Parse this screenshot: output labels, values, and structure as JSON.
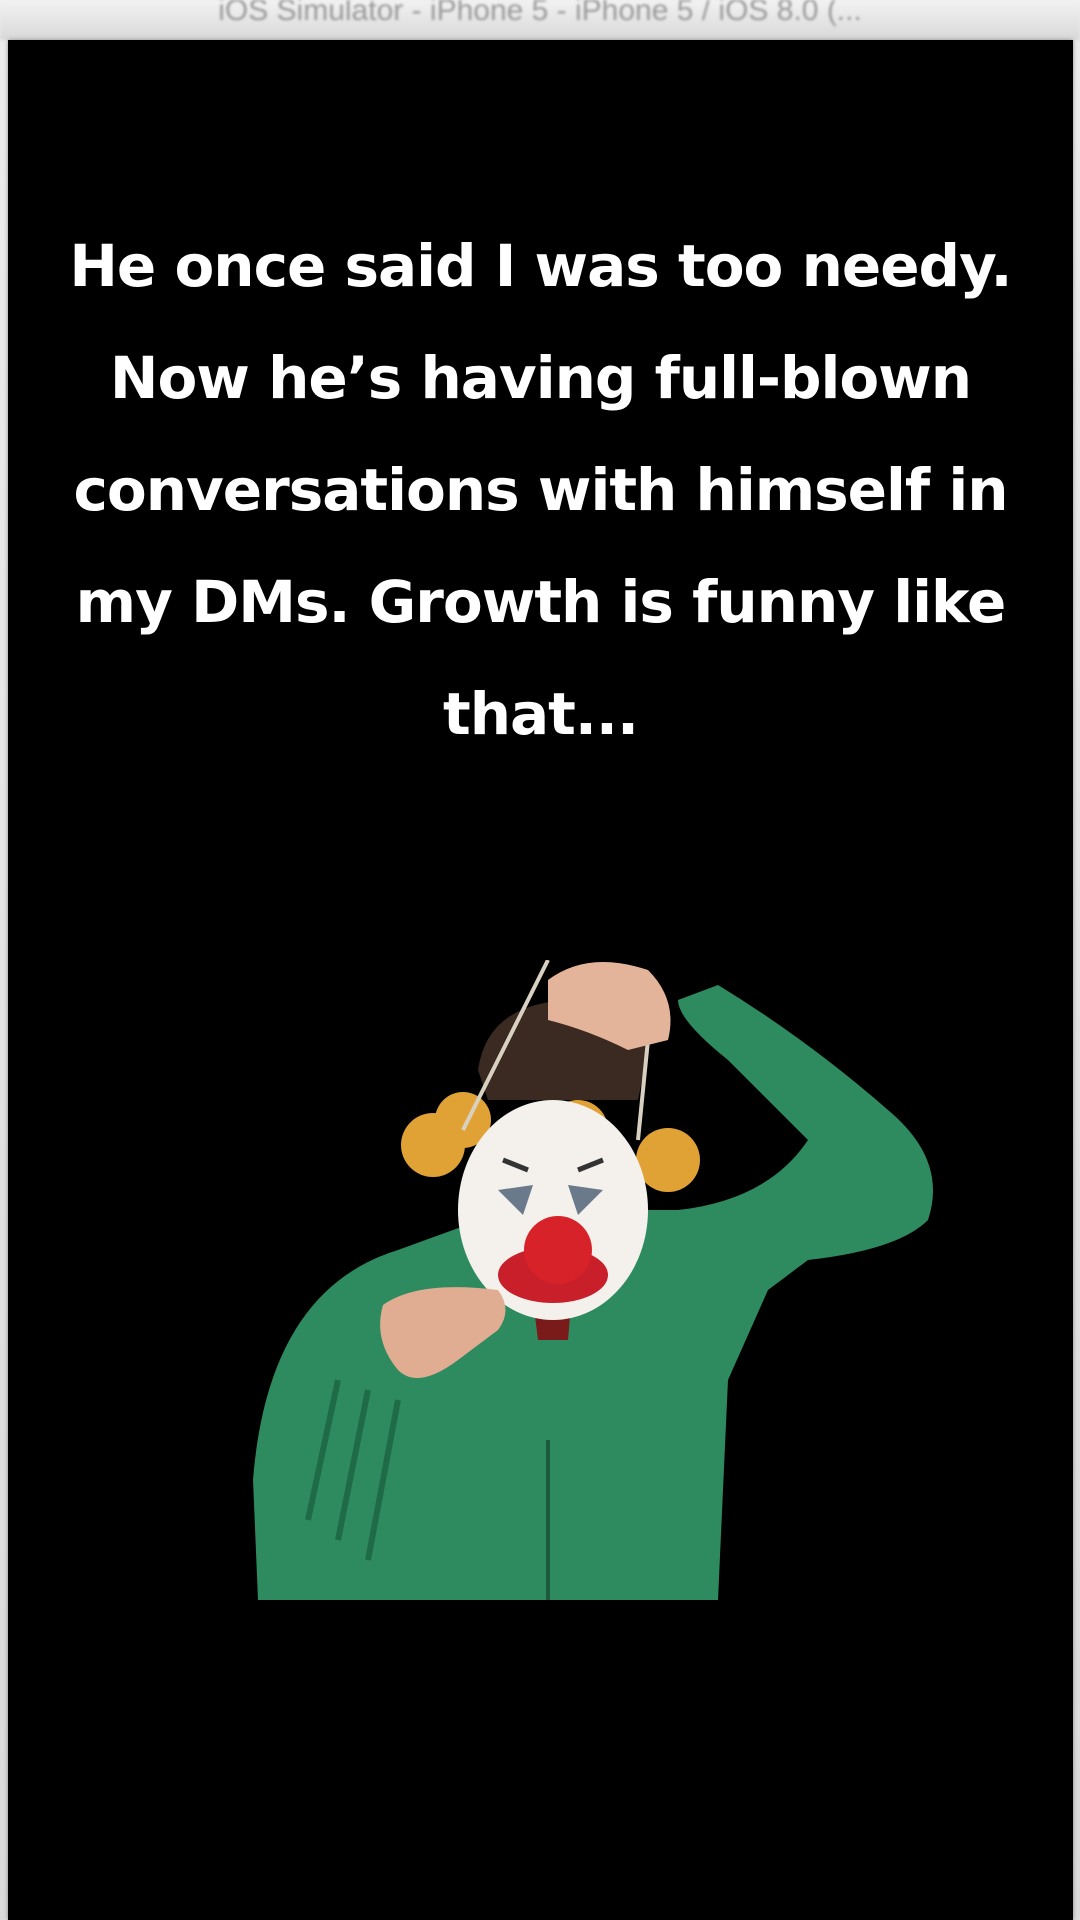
{
  "window": {
    "title": "iOS Simulator - iPhone 5 - iPhone 5 / iOS 8.0 (..."
  },
  "post": {
    "caption": "He once said I was too needy. Now he’s having full-blown conversations with himself in my DMs. Growth is funny like that...",
    "figure": {
      "sweater_color": "#2e8b5f",
      "mask_color": "#f4f1ec",
      "nose_color": "#d8222a",
      "wig_color": "#e0a235"
    }
  }
}
